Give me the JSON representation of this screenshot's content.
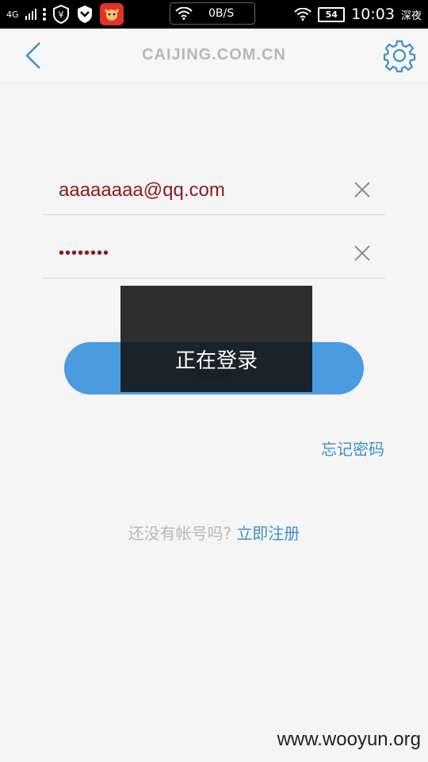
{
  "status_bar": {
    "network": "4G",
    "speed": "0B/S",
    "battery": "54",
    "time": "10:03",
    "mode": "深夜"
  },
  "header": {
    "brand": "CAIJING.COM.CN"
  },
  "form": {
    "email_value": "aaaaaaaa@qq.com",
    "password_value": "••••••••",
    "login_label": "登录"
  },
  "toast": {
    "text": "正在登录"
  },
  "links": {
    "forgot_password": "忘记密码",
    "no_account": "还没有帐号吗?",
    "register": "立即注册"
  },
  "watermark": "www.wooyun.org",
  "colors": {
    "accent": "#4a9be0",
    "link": "#3f8fc8",
    "input_text": "#8b1a1a"
  }
}
